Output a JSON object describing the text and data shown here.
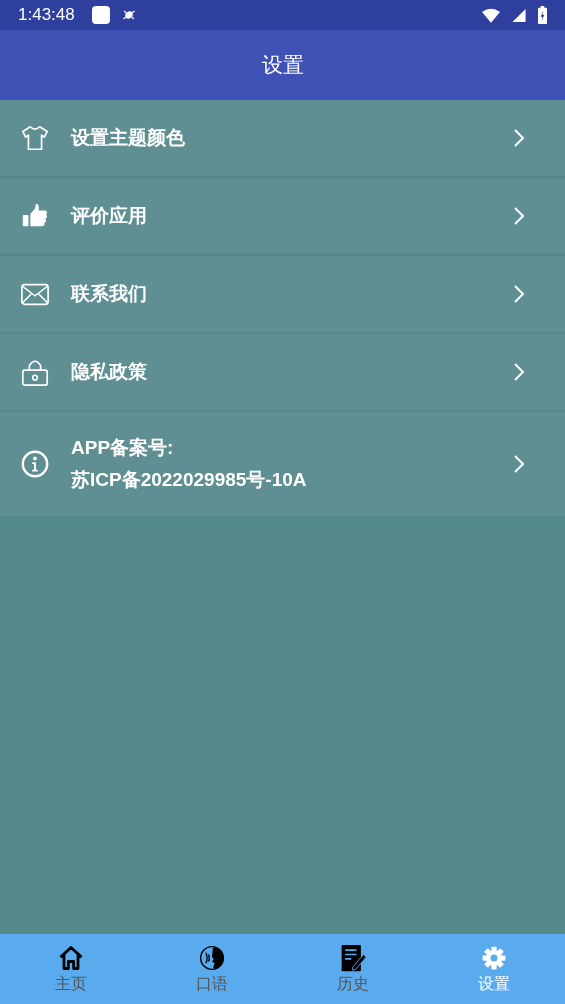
{
  "status_bar": {
    "time": "1:43:48"
  },
  "app_bar": {
    "title": "设置"
  },
  "settings_items": [
    {
      "lines": [
        "设置主题颜色"
      ]
    },
    {
      "lines": [
        "评价应用"
      ]
    },
    {
      "lines": [
        "联系我们"
      ]
    },
    {
      "lines": [
        "隐私政策"
      ]
    },
    {
      "lines": [
        "APP备案号:",
        "苏ICP备2022029985号-10A"
      ]
    }
  ],
  "bottom_nav": [
    {
      "label": "主页",
      "selected": false
    },
    {
      "label": "口语",
      "selected": false
    },
    {
      "label": "历史",
      "selected": false
    },
    {
      "label": "设置",
      "selected": true
    }
  ]
}
